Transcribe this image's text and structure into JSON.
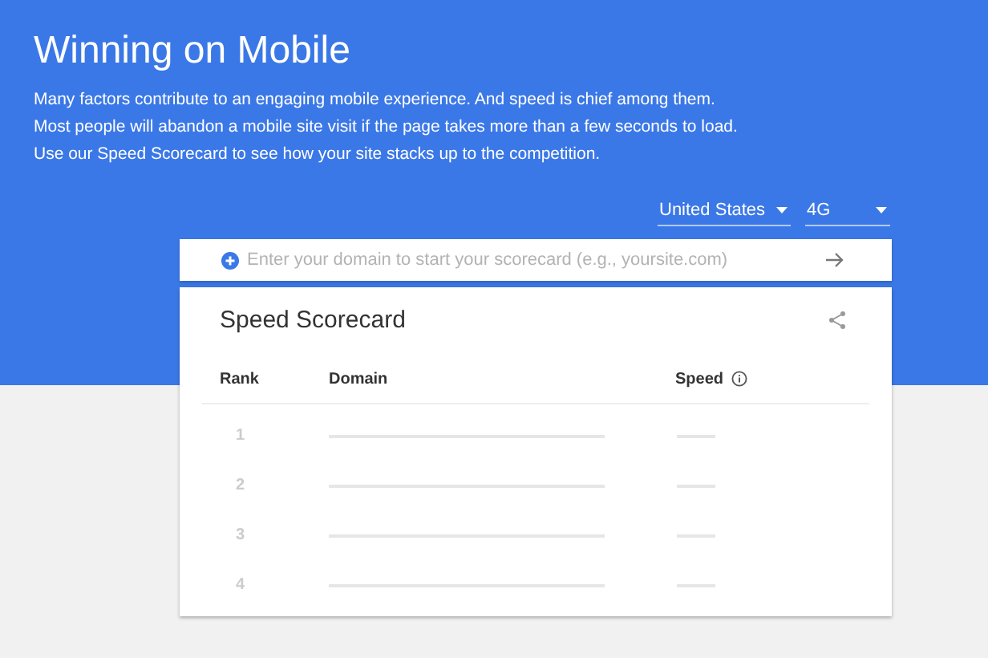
{
  "header": {
    "title": "Winning on Mobile",
    "description": "Many factors contribute to an engaging mobile experience. And speed is chief among them. Most people will abandon a mobile site visit if the page takes more than a few seconds to load. Use our Speed Scorecard to see how your site stacks up to the competition."
  },
  "filters": [
    {
      "value": "United States"
    },
    {
      "value": "4G"
    }
  ],
  "search": {
    "placeholder": "Enter your domain to start your scorecard (e.g., yoursite.com)"
  },
  "scorecard": {
    "title": "Speed Scorecard",
    "columns": [
      "Rank",
      "Domain",
      "Speed"
    ],
    "rows": [
      {
        "rank": "1"
      },
      {
        "rank": "2"
      },
      {
        "rank": "3"
      },
      {
        "rank": "4"
      }
    ]
  }
}
